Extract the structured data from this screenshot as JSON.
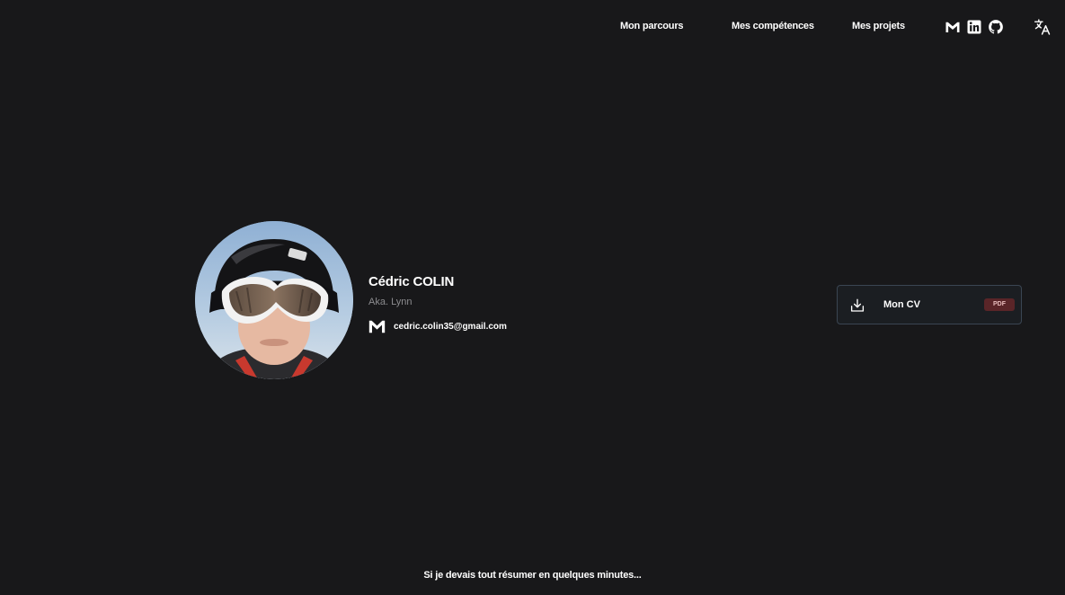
{
  "nav": {
    "links": [
      {
        "label": "Mon parcours"
      },
      {
        "label": "Mes compétences"
      },
      {
        "label": "Mes projets"
      }
    ],
    "social_icons": [
      "gmail-icon",
      "linkedin-icon",
      "github-icon"
    ],
    "language_icon": "translate-icon"
  },
  "profile": {
    "name": "Cédric COLIN",
    "aka": "Aka. Lynn",
    "email": "cedric.colin35@gmail.com",
    "email_icon": "gmail-icon",
    "avatar": "profile photo"
  },
  "cv": {
    "label": "Mon CV",
    "badge": "PDF",
    "icon": "download-icon"
  },
  "summary": {
    "text": "Si je devais tout résumer en quelques minutes..."
  },
  "colors": {
    "background": "#18181a",
    "text": "#ffffff",
    "muted": "#8c8c8f",
    "cv_border": "#3a4552",
    "badge_bg": "#5a2528"
  }
}
